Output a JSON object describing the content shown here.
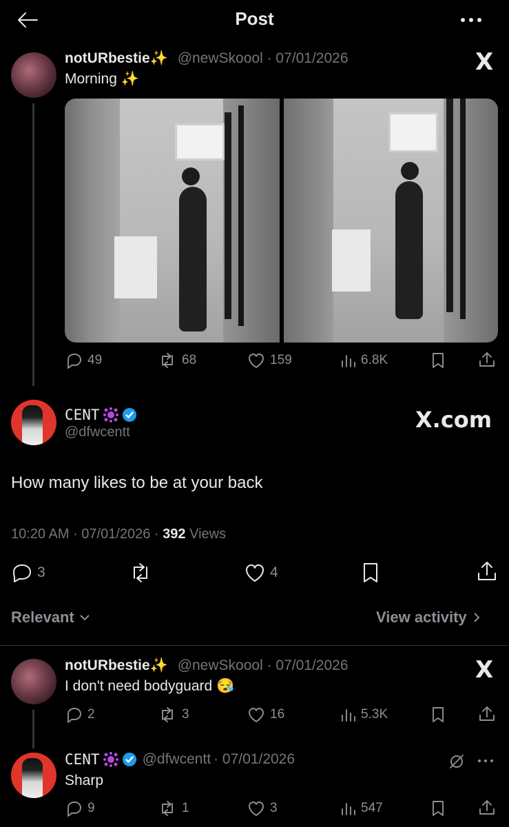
{
  "header": {
    "title": "Post"
  },
  "quoted_post": {
    "display_name": "notURbestie",
    "sparkle": "✨",
    "handle": "@newSkoool",
    "date": "· 07/01/2026",
    "text": "Morning",
    "text_sparkle": "✨",
    "stats": {
      "replies": "49",
      "reposts": "68",
      "likes": "159",
      "views": "6.8K"
    }
  },
  "main_post": {
    "display_name": "CENT",
    "handle": "@dfwcentt",
    "brand": "X.com",
    "text": "How many likes to be at your back",
    "time": "10:20 AM · 07/01/2026 · ",
    "views_count": "392",
    "views_label": " Views",
    "stats": {
      "replies": "3",
      "likes": "4"
    }
  },
  "filter": {
    "relevant": "Relevant",
    "view_activity": "View activity"
  },
  "reply1": {
    "display_name": "notURbestie",
    "sparkle": "✨",
    "handle": "@newSkoool",
    "date": "· 07/01/2026",
    "text": "I don't need bodyguard",
    "emoji": "😪",
    "stats": {
      "replies": "2",
      "reposts": "3",
      "likes": "16",
      "views": "5.3K"
    }
  },
  "reply2": {
    "display_name": "CENT",
    "handle": "@dfwcentt",
    "date": "· 07/01/2026",
    "text": "Sharp",
    "stats": {
      "replies": "9",
      "reposts": "1",
      "likes": "3",
      "views": "547"
    }
  },
  "colors": {
    "background": "#000000",
    "text": "#e7e9ea",
    "muted": "#71767b",
    "verified": "#1d9bf0",
    "avatar_red": "#e0352b"
  }
}
